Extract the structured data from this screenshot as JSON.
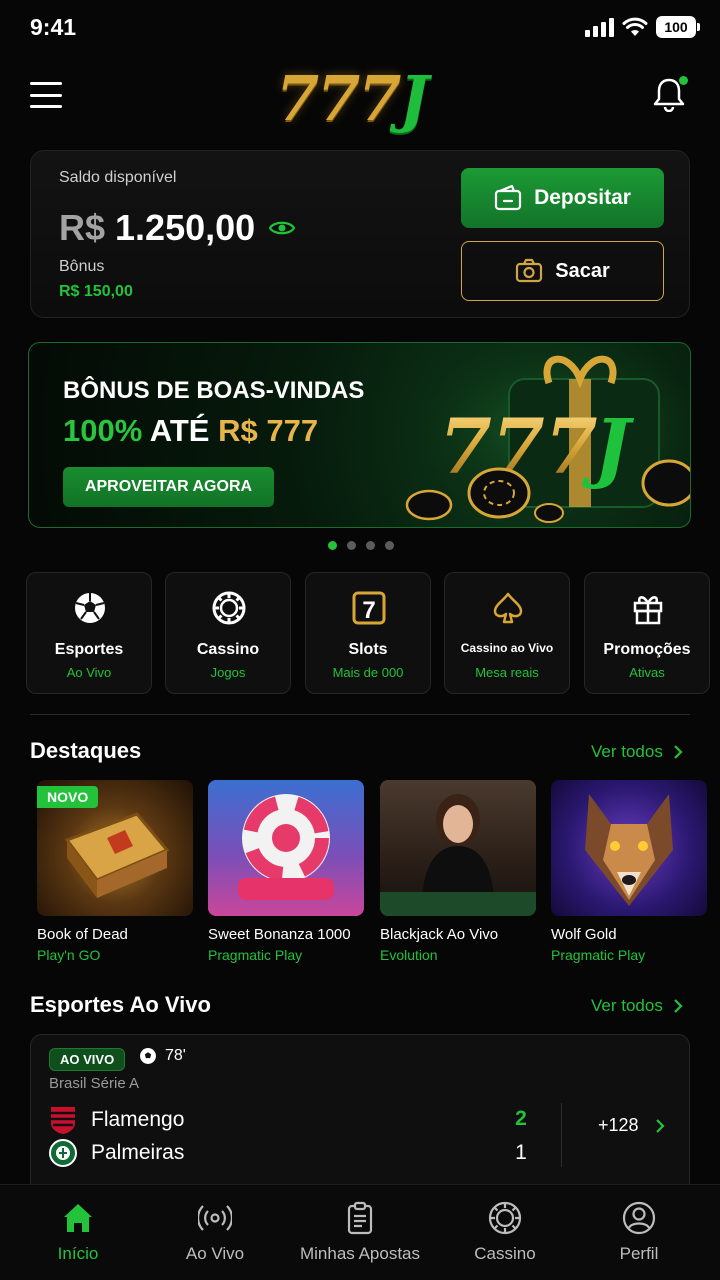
{
  "status_bar": {
    "time": "9:41",
    "battery": "100"
  },
  "header": {
    "logo_gold": "777",
    "logo_green": "J"
  },
  "balance": {
    "label": "Saldo disponível",
    "currency": "R$",
    "amount": "1.250,00",
    "bonus_label": "Bônus",
    "bonus_amount": "R$ 150,00",
    "deposit_label": "Depositar",
    "withdraw_label": "Sacar"
  },
  "banner": {
    "title": "BÔNUS DE BOAS-VINDAS",
    "offer_percent": "100%",
    "offer_mid": "ATÉ",
    "offer_value": "R$ 777",
    "cta": "APROVEITAR AGORA",
    "art_gold": "777",
    "art_green": "J",
    "slides": 4,
    "active_slide": 1
  },
  "categories": [
    {
      "name": "Esportes",
      "sub": "Ao Vivo",
      "icon": "soccer-ball-icon"
    },
    {
      "name": "Cassino",
      "sub": "Jogos",
      "icon": "casino-chip-icon"
    },
    {
      "name": "Slots",
      "sub": "Mais de 000",
      "icon": "slot-seven-icon"
    },
    {
      "name": "Cassino ao Vivo",
      "sub": "Mesa reais",
      "icon": "spade-icon"
    },
    {
      "name": "Promoções",
      "sub": "Ativas",
      "icon": "gift-icon"
    }
  ],
  "highlights": {
    "title": "Destaques",
    "see_all": "Ver todos",
    "new_badge": "NOVO",
    "games": [
      {
        "name": "Book of Dead",
        "provider": "Play'n GO"
      },
      {
        "name": "Sweet Bonanza 1000",
        "provider": "Pragmatic Play"
      },
      {
        "name": "Blackjack Ao Vivo",
        "provider": "Evolution"
      },
      {
        "name": "Wolf Gold",
        "provider": "Pragmatic Play"
      }
    ]
  },
  "live_sports": {
    "title": "Esportes Ao Vivo",
    "see_all": "Ver todos",
    "match": {
      "badge": "AO VIVO",
      "minute": "78'",
      "league": "Brasil Série A",
      "home_team": "Flamengo",
      "home_score": "2",
      "away_team": "Palmeiras",
      "away_score": "1",
      "markets": "+128"
    }
  },
  "nav": [
    {
      "label": "Início",
      "icon": "home-icon",
      "active": true
    },
    {
      "label": "Ao Vivo",
      "icon": "broadcast-icon",
      "active": false
    },
    {
      "label": "Minhas Apostas",
      "icon": "clipboard-icon",
      "active": false
    },
    {
      "label": "Cassino",
      "icon": "casino-chip-icon",
      "active": false
    },
    {
      "label": "Perfil",
      "icon": "user-icon",
      "active": false
    }
  ],
  "colors": {
    "accent_green": "#22c23a",
    "gold": "#d8a637",
    "background": "#060606"
  }
}
